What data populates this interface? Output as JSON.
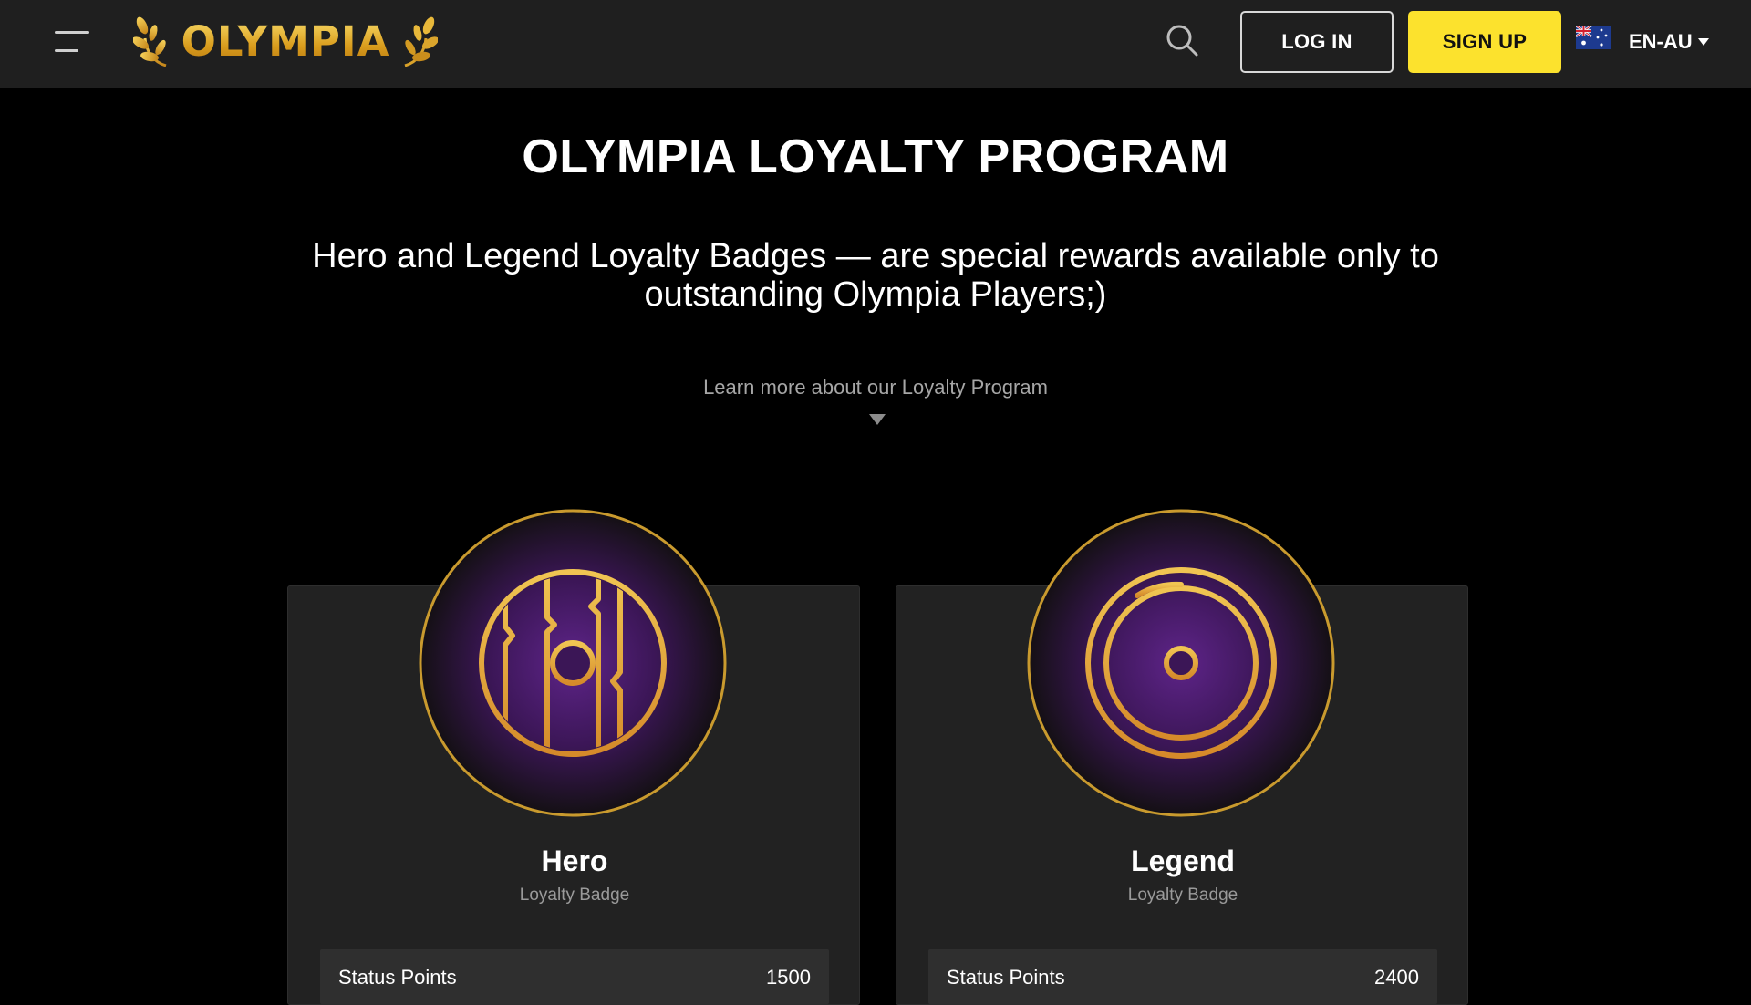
{
  "header": {
    "logo_text": "OLYMPIA",
    "login_label": "LOG IN",
    "signup_label": "SIGN UP",
    "language": "EN-AU",
    "icons": [
      "menu-icon",
      "laurel-icon",
      "search-icon",
      "australia-flag-icon",
      "caret-down-icon"
    ]
  },
  "hero": {
    "title": "OLYMPIA LOYALTY PROGRAM",
    "subtitle": "Hero and Legend Loyalty Badges — are special rewards available only to outstanding Olympia Players;)",
    "learn_more": "Learn more about our Loyalty Program"
  },
  "badges": [
    {
      "name": "Hero",
      "subtitle": "Loyalty Badge",
      "stat_label": "Status Points",
      "stat_value": "1500",
      "icon": "vertical-plank-shield-icon"
    },
    {
      "name": "Legend",
      "subtitle": "Loyalty Badge",
      "stat_label": "Status Points",
      "stat_value": "2400",
      "icon": "horizontal-band-shield-icon"
    }
  ],
  "colors": {
    "header_bg": "#1f1f1f",
    "page_bg": "#000000",
    "accent_yellow": "#fce22d",
    "gold": "#e0a52a",
    "badge_purple": "#5a2584",
    "card_bg": "#222222",
    "muted_text": "#a6a6a6"
  }
}
